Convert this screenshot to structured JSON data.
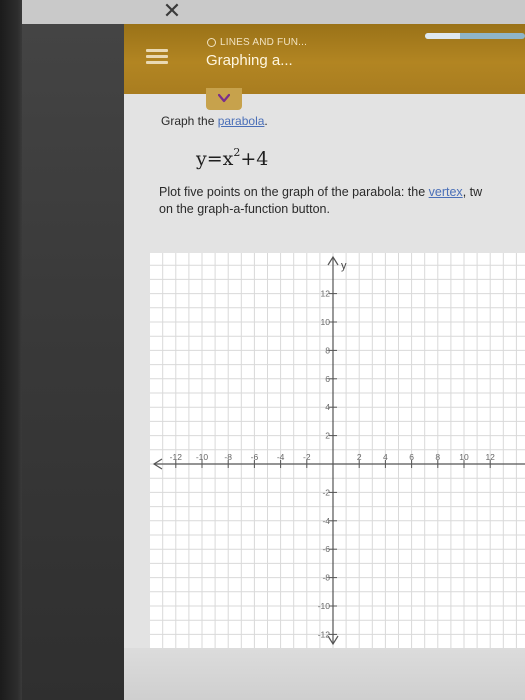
{
  "window": {
    "close_glyph": "✕"
  },
  "header": {
    "subtitle": "LINES AND FUN...",
    "title": "Graphing a...",
    "progress_fraction": 0.35,
    "menu_icon": "hamburger-menu-icon",
    "collapse_icon": "chevron-down-icon"
  },
  "colors": {
    "header": "#b28522",
    "link": "#4a6fb8",
    "progress_track": "#8fb5c8"
  },
  "question": {
    "prompt_prefix": "Graph the ",
    "prompt_link": "parabola",
    "prompt_suffix": ".",
    "equation_lhs": "y=x",
    "equation_exp": "2",
    "equation_rhs": "+4",
    "instructions_line1_prefix": "Plot five points on the graph of the parabola: the ",
    "instructions_line1_link": "vertex",
    "instructions_line1_suffix": ", tw",
    "instructions_line2": "on the graph-a-function button."
  },
  "graph": {
    "x_axis_name": "y",
    "x_ticks": [
      -12,
      -10,
      -8,
      -6,
      -4,
      -2,
      2,
      4,
      6,
      8,
      10,
      12
    ],
    "y_ticks": [
      12,
      10,
      8,
      6,
      4,
      2,
      -2,
      -4,
      -6,
      -8,
      -10,
      -12
    ]
  }
}
